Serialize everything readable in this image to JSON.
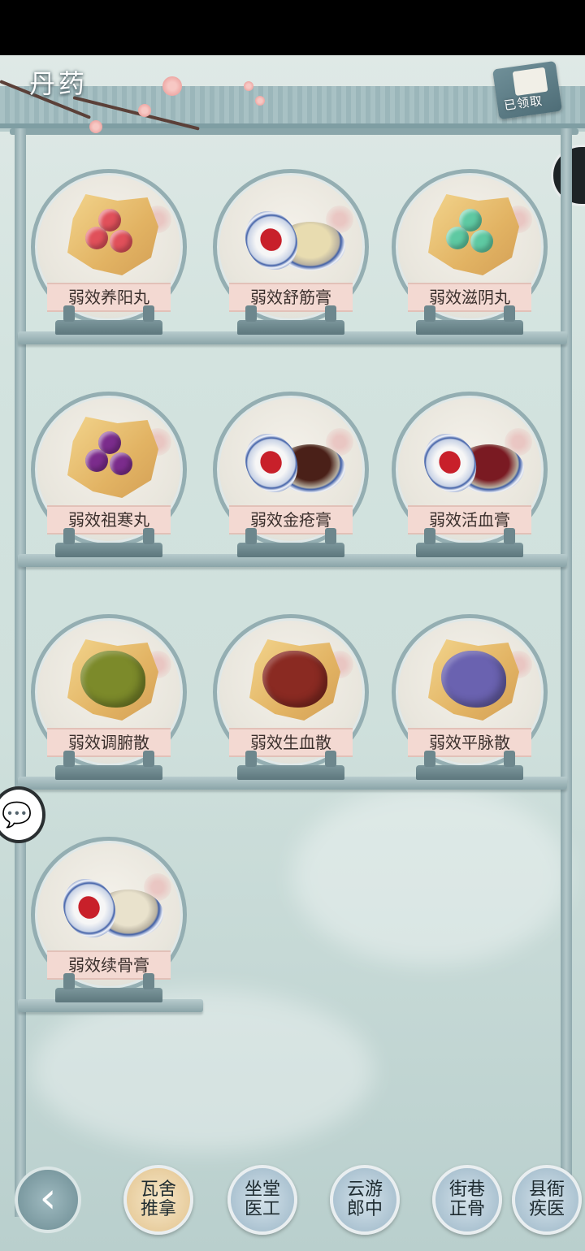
{
  "title": "丹药",
  "claim": {
    "label": "已领取"
  },
  "side_tab": {
    "glyph": "‹"
  },
  "chat_button": {
    "glyph": "💬"
  },
  "items": [
    {
      "name": "弱效养阳丸",
      "kind": "pill",
      "color": "#e0505a"
    },
    {
      "name": "弱效舒筋膏",
      "kind": "tin",
      "color": "#e8dcb0"
    },
    {
      "name": "弱效滋阴丸",
      "kind": "pill",
      "color": "#5ec9a2"
    },
    {
      "name": "弱效祖寒丸",
      "kind": "pill",
      "color": "#7b2c8c"
    },
    {
      "name": "弱效金疮膏",
      "kind": "tin",
      "color": "#4a2018"
    },
    {
      "name": "弱效活血膏",
      "kind": "tin",
      "color": "#7a1a22"
    },
    {
      "name": "弱效调腑散",
      "kind": "powder",
      "color": "#7c8a2a"
    },
    {
      "name": "弱效生血散",
      "kind": "powder",
      "color": "#8a2a22"
    },
    {
      "name": "弱效平脉散",
      "kind": "powder",
      "color": "#6a62b0"
    },
    {
      "name": "弱效续骨膏",
      "kind": "tin",
      "color": "#e9e2cc"
    }
  ],
  "nav": {
    "back_glyph": "‹",
    "tabs": [
      {
        "line1": "瓦舍",
        "line2": "推拿",
        "active": true
      },
      {
        "line1": "坐堂",
        "line2": "医工",
        "active": false
      },
      {
        "line1": "云游",
        "line2": "郎中",
        "active": false
      },
      {
        "line1": "街巷",
        "line2": "正骨",
        "active": false
      },
      {
        "line1": "县衙",
        "line2": "疾医",
        "active": false
      }
    ]
  }
}
